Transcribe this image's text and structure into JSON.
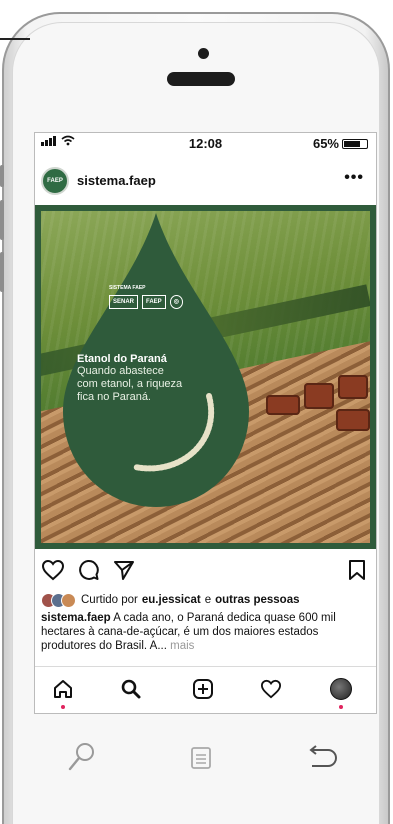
{
  "status_bar": {
    "time": "12:08",
    "battery": "65%"
  },
  "post": {
    "username": "sistema.faep",
    "more": "•••",
    "avatar_label": "FAEP",
    "image": {
      "logo_label": "SISTEMA FAEP",
      "logos": [
        "SENAR",
        "FAEP",
        "◎"
      ],
      "headline": "Etanol do Paraná",
      "text_lines": [
        "Quando abastece",
        "com etanol, a riqueza",
        "fica no Paraná."
      ]
    },
    "likes": {
      "prefix": "Curtido por",
      "user": "eu.jessicat",
      "joiner": "e",
      "others": "outras pessoas"
    },
    "caption": {
      "username": "sistema.faep",
      "text": "A cada ano, o Paraná dedica quase 600 mil hectares à cana-de-açúcar, é um dos maiores estados produtores do Brasil. A...",
      "more": "mais"
    }
  },
  "colors": {
    "brand_green": "#2f5b3b",
    "notification": "#e0245e"
  },
  "icons": {
    "actions": [
      "heart-icon",
      "comment-icon",
      "share-icon",
      "bookmark-icon"
    ],
    "nav": [
      "home-icon",
      "search-icon",
      "new-post-icon",
      "activity-icon",
      "profile-icon"
    ],
    "hardware": [
      "search-icon",
      "menu-icon",
      "back-icon"
    ]
  }
}
